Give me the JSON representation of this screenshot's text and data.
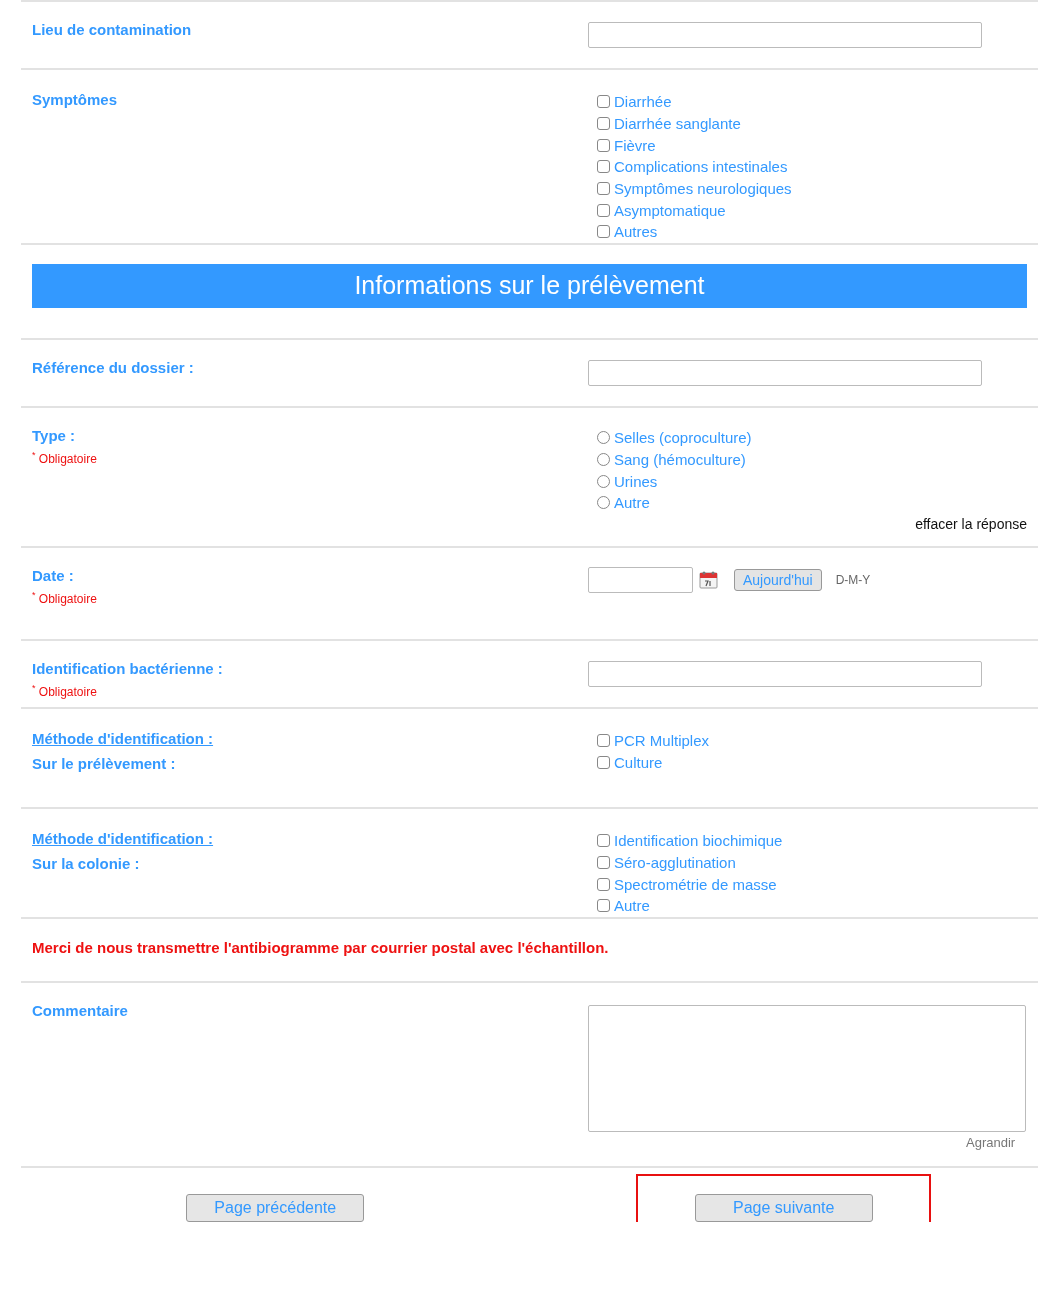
{
  "rows": [
    {
      "kind": "text",
      "label": "Lieu de contamination"
    },
    {
      "kind": "checkboxes",
      "label": "Symptômes",
      "options": [
        {
          "label": "Diarrhée",
          "checked": false
        },
        {
          "label": "Diarrhée sanglante",
          "checked": false
        },
        {
          "label": "Fièvre",
          "checked": false
        },
        {
          "label": "Complications intestinales",
          "checked": false
        },
        {
          "label": "Symptômes neurologiques",
          "checked": false
        },
        {
          "label": "Asymptomatique",
          "checked": false
        },
        {
          "label": "Autres",
          "checked": false
        }
      ]
    },
    {
      "kind": "header",
      "title": "Informations sur le prélèvement"
    },
    {
      "kind": "text",
      "label": "Référence du dossier :"
    },
    {
      "kind": "radios",
      "label": "Type :",
      "required": "$^{*}$ Obligatoire",
      "clear": "effacer la réponse",
      "options": [
        {
          "label": "Selles (coproculture)",
          "selected": false
        },
        {
          "label": "Sang (hémoculture)",
          "selected": false
        },
        {
          "label": "Urines",
          "selected": false
        },
        {
          "label": "Autre",
          "selected": false
        }
      ]
    },
    {
      "kind": "date",
      "label": "Date :",
      "required": "$^{*}$ Obligatoire",
      "today": "Aujourd'hui",
      "format": "D-M-Y"
    },
    {
      "kind": "text",
      "label": "Identification bactérienne :",
      "required": "$^{*}$ Obligatoire"
    },
    {
      "kind": "checkboxes",
      "link": "Méthode d'identification :",
      "label": "Sur le prélèvement :",
      "options": [
        {
          "label": "PCR Multiplex",
          "checked": false
        },
        {
          "label": "Culture",
          "checked": false
        }
      ]
    },
    {
      "kind": "checkboxes",
      "link": "Méthode d'identification :",
      "label": "Sur la colonie :",
      "options": [
        {
          "label": "Identification biochimique",
          "checked": false
        },
        {
          "label": "Séro-agglutination",
          "checked": false
        },
        {
          "label": "Spectrométrie de masse",
          "checked": false
        },
        {
          "label": "Autre",
          "checked": false
        }
      ]
    },
    {
      "kind": "notice",
      "text": "Merci de nous transmettre l'antibiogramme par courrier postal avec l'échantillon."
    },
    {
      "kind": "textarea",
      "label": "Commentaire",
      "resize": "Agrandir"
    },
    {
      "kind": "nav",
      "buttons": [
        {
          "label": "Page précédente",
          "highlighted": false
        },
        {
          "label": "Page suivante",
          "highlighted": true
        }
      ]
    }
  ]
}
